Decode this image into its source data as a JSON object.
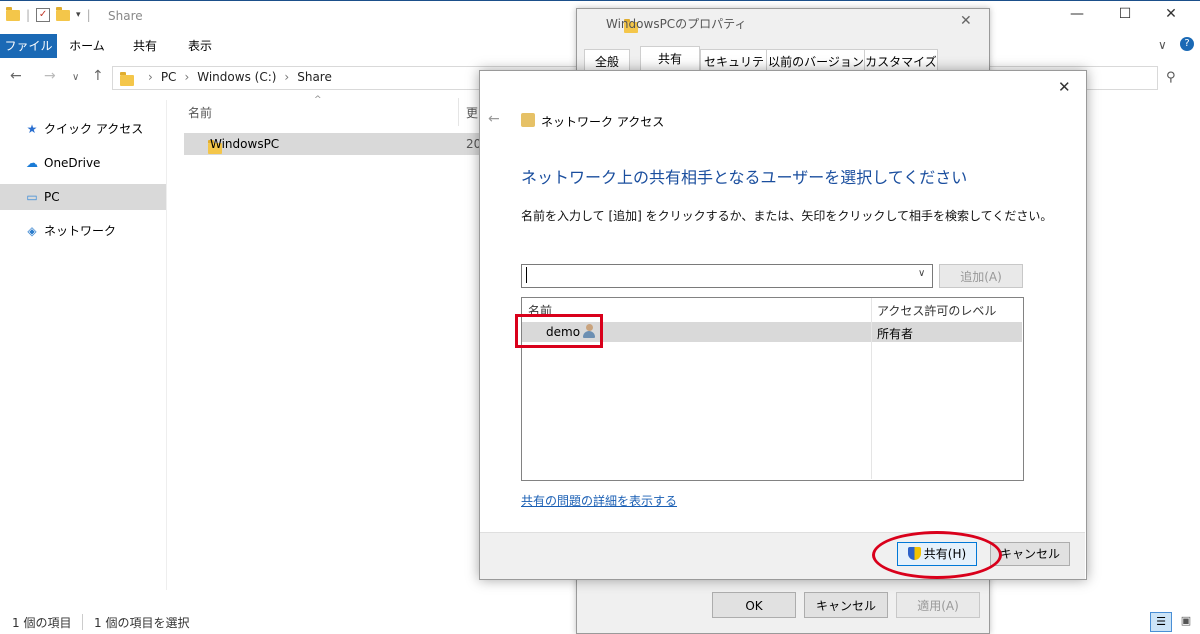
{
  "explorer": {
    "title": "Share",
    "ribbon_tabs": [
      "ファイル",
      "ホーム",
      "共有",
      "表示"
    ],
    "address": [
      "PC",
      "Windows (C:)",
      "Share"
    ],
    "nav": [
      {
        "label": "クイック アクセス",
        "icon": "star-icon"
      },
      {
        "label": "OneDrive",
        "icon": "cloud-icon"
      },
      {
        "label": "PC",
        "icon": "computer-icon"
      },
      {
        "label": "ネットワーク",
        "icon": "network-icon"
      }
    ],
    "columns": {
      "name": "名前",
      "date": "更"
    },
    "files": [
      {
        "name": "WindowsPC",
        "date": "20"
      }
    ],
    "status": {
      "count": "1 個の項目",
      "selected": "1 個の項目を選択"
    }
  },
  "properties": {
    "title": "WindowsPCのプロパティ",
    "tabs": [
      "全般",
      "共有",
      "セキュリティ",
      "以前のバージョン",
      "カスタマイズ"
    ],
    "ok_label": "OK",
    "cancel_label": "キャンセル",
    "apply_label": "適用(A)"
  },
  "dialog": {
    "title": "ネットワーク アクセス",
    "heading": "ネットワーク上の共有相手となるユーザーを選択してください",
    "instruction": "名前を入力して [追加] をクリックするか、または、矢印をクリックして相手を検索してください。",
    "add_label": "追加(A)",
    "col_name": "名前",
    "col_level": "アクセス許可のレベル",
    "users": [
      {
        "name": "demo",
        "level": "所有者"
      }
    ],
    "link": "共有の問題の詳細を表示する",
    "share_label": "共有(H)",
    "cancel_label": "キャンセル"
  }
}
